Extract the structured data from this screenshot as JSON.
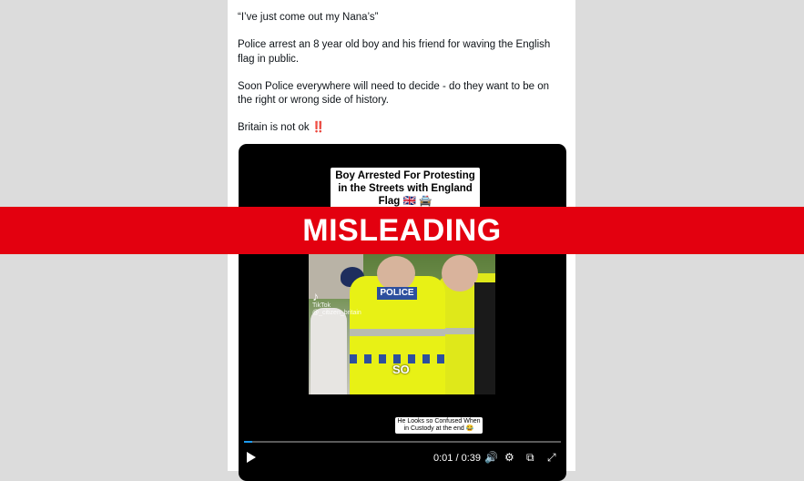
{
  "post": {
    "lines": [
      "“I’ve just come out my Nana’s”",
      "Police arrest an 8 year old boy and his friend for waving the English flag in public.",
      "Soon Police everywhere will need to decide - do they want to be on the right or wrong side of history.",
      "Britain is not ok"
    ],
    "emoji": "‼️"
  },
  "video": {
    "caption_top": "Boy Arrested For Protesting in the Streets with England Flag 🇬🇧 🚔",
    "badge_text": "POLICE",
    "overlay_word": "SO",
    "tiktok_label": "TikTok",
    "tiktok_handle": "@_citizen_britain",
    "caption_bottom": "He Looks so Confused When in Custody at the end 😂",
    "progress": 0.026,
    "timecode": "0:01 / 0:39",
    "icons": [
      "play-icon",
      "volume-icon",
      "settings-icon",
      "picture-in-picture-icon",
      "fullscreen-icon"
    ]
  },
  "banner": {
    "label": "MISLEADING",
    "color": "#e3000f"
  }
}
